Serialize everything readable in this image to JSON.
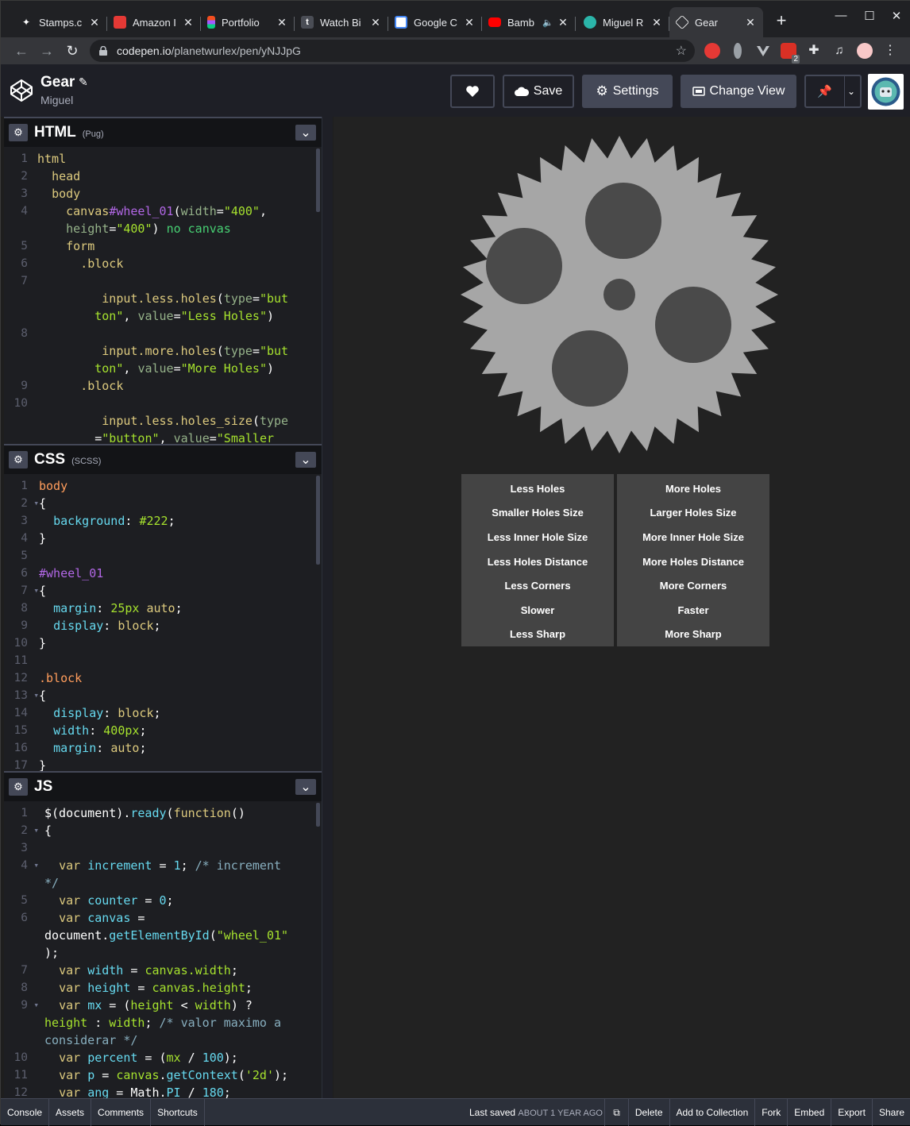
{
  "browser": {
    "tabs": [
      {
        "title": "Stamps.c",
        "icon": "stamps-icon",
        "color": "#ffffff"
      },
      {
        "title": "Amazon I",
        "icon": "amazon-icon",
        "color": "#e53935"
      },
      {
        "title": "Portfolio",
        "icon": "figma-icon",
        "color": "#f24e1e"
      },
      {
        "title": "Watch Bi",
        "icon": "tumblr-icon",
        "color": "#35465c"
      },
      {
        "title": "Google C",
        "icon": "google-calendar-icon",
        "color": "#4285f4"
      },
      {
        "title": "Bamb",
        "icon": "youtube-icon",
        "color": "#ff0000"
      },
      {
        "title": "Miguel R",
        "icon": "globe-icon",
        "color": "#2bb5a9"
      },
      {
        "title": "Gear",
        "icon": "codepen-icon",
        "color": "#ffffff"
      }
    ],
    "url_host": "codepen.io",
    "url_path": "/planetwurlex/pen/yNJJpG",
    "extension_badge": "2"
  },
  "header": {
    "title": "Gear",
    "author": "Miguel",
    "save_label": "Save",
    "settings_label": "Settings",
    "change_view_label": "Change View"
  },
  "html_panel": {
    "title": "HTML",
    "subtitle": "(Pug)"
  },
  "css_panel": {
    "title": "CSS",
    "subtitle": "(SCSS)"
  },
  "js_panel": {
    "title": "JS",
    "subtitle": ""
  },
  "preview": {
    "buttons_left": [
      "Less Holes",
      "Smaller Holes Size",
      "Less Inner Hole Size",
      "Less Holes Distance",
      "Less Corners",
      "Slower",
      "Less Sharp"
    ],
    "buttons_right": [
      "More Holes",
      "Larger Holes Size",
      "More Inner Hole Size",
      "More Holes Distance",
      "More Corners",
      "Faster",
      "More Sharp"
    ]
  },
  "footer": {
    "console": "Console",
    "assets": "Assets",
    "comments": "Comments",
    "shortcuts": "Shortcuts",
    "last_saved": "Last saved",
    "last_saved_when": "ABOUT 1 YEAR AGO",
    "delete": "Delete",
    "add_to_collection": "Add to Collection",
    "fork": "Fork",
    "embed": "Embed",
    "export": "Export",
    "share": "Share"
  },
  "colors": {
    "gear_fill": "#a6a6a6",
    "gear_hole": "#4a4a4a",
    "preview_bg": "#222222"
  }
}
